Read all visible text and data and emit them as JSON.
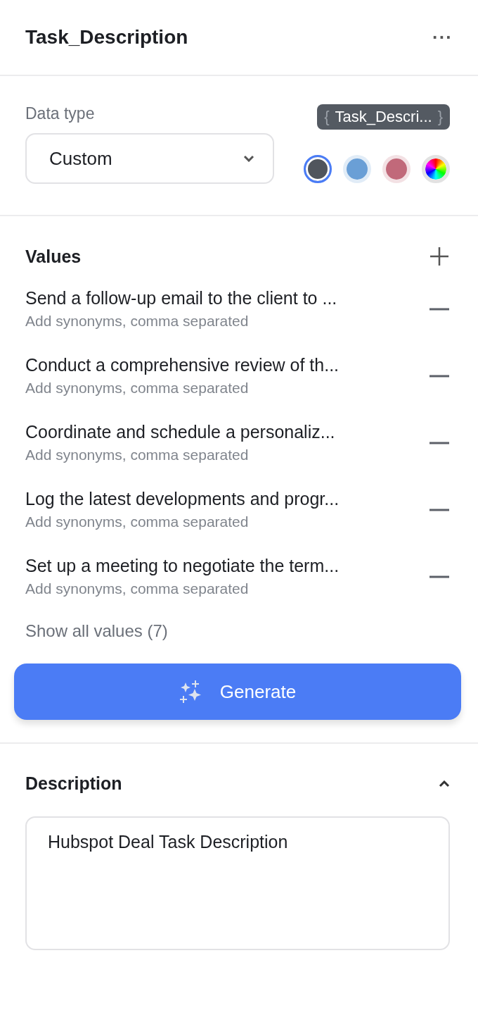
{
  "header": {
    "title": "Task_Description",
    "menu_icon": "···"
  },
  "data_type": {
    "label": "Data type",
    "value": "Custom",
    "chip": {
      "open": "{",
      "label": "Task_Descri...",
      "close": "}"
    },
    "swatches": [
      {
        "kind": "solid",
        "color": "#50555d",
        "selected": true
      },
      {
        "kind": "solid",
        "color": "#6a9fd6",
        "selected": false
      },
      {
        "kind": "solid",
        "color": "#c1697a",
        "selected": false
      },
      {
        "kind": "spectrum",
        "selected": false
      }
    ]
  },
  "values": {
    "title": "Values",
    "items": [
      {
        "text": "Send a follow-up email to the client to ...",
        "placeholder": "Add synonyms, comma separated"
      },
      {
        "text": "Conduct a comprehensive review of th...",
        "placeholder": "Add synonyms, comma separated"
      },
      {
        "text": "Coordinate and schedule a personaliz...",
        "placeholder": "Add synonyms, comma separated"
      },
      {
        "text": "Log the latest developments and progr...",
        "placeholder": "Add synonyms, comma separated"
      },
      {
        "text": "Set up a meeting to negotiate the term...",
        "placeholder": "Add synonyms, comma separated"
      }
    ],
    "show_all": "Show all values (7)"
  },
  "generate_button": "Generate",
  "description": {
    "title": "Description",
    "expanded": true,
    "value": "Hubspot Deal Task Description"
  }
}
